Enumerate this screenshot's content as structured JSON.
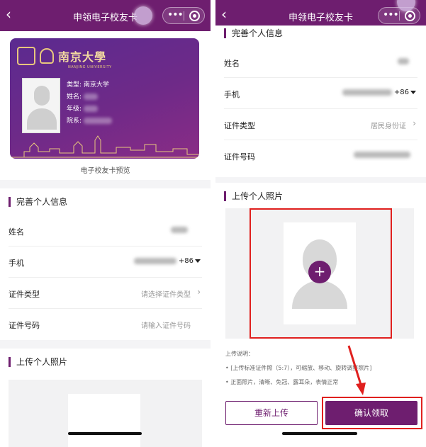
{
  "nav": {
    "title": "申领电子校友卡",
    "back_icon": "back-icon",
    "more_icon": "more-icon",
    "close_icon": "close-icon"
  },
  "card": {
    "university_name": "南京大學",
    "university_en": "NANJING UNIVERSITY",
    "type_label": "类型:",
    "type_value": "南京大学",
    "name_label": "姓名:",
    "year_label": "年级:",
    "dept_label": "院系:",
    "caption": "电子校友卡预览"
  },
  "info_section": {
    "title": "完善个人信息",
    "name_label": "姓名",
    "phone_label": "手机",
    "phone_code": "+86",
    "id_type_label": "证件类型",
    "id_type_placeholder": "请选择证件类型",
    "id_type_value": "居民身份证",
    "id_number_label": "证件号码",
    "id_number_placeholder": "请输入证件号码"
  },
  "photo_section": {
    "title": "上传个人照片",
    "upload_icon": "plus-icon",
    "notes_title": "上传说明：",
    "note_1": "• [上传标准证件照（5:7），可缩放、移动、旋转调整照片]",
    "note_2": "• 正面照片，清晰、免冠、露耳朵，表情正常"
  },
  "buttons": {
    "reupload": "重新上传",
    "confirm": "确认领取"
  },
  "colors": {
    "brand": "#6e1e6f",
    "highlight": "#e0201e"
  }
}
